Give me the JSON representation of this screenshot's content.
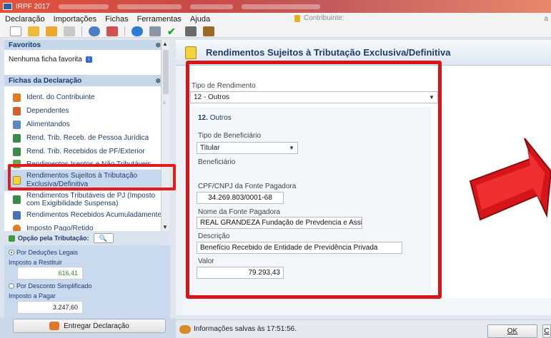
{
  "window": {
    "title": "IRPF 2017"
  },
  "menu": [
    "Declaração",
    "Importações",
    "Fichas",
    "Ferramentas",
    "Ajuda"
  ],
  "contribuinte_label": "Contribuinte:",
  "contribuinte_right": "a",
  "sidebar": {
    "favorites_header": "Favoritos",
    "favorites_empty": "Nenhuma ficha favorita",
    "fichas_header": "Fichas da Declaração",
    "items": [
      {
        "label": "Ident. do Contribuinte",
        "icon": "person-icon",
        "color": "#e07b28"
      },
      {
        "label": "Dependentes",
        "icon": "dependents-icon",
        "color": "#d4602c"
      },
      {
        "label": "Alimentandos",
        "icon": "alimentandos-icon",
        "color": "#5a8ac2"
      },
      {
        "label": "Rend. Trib. Receb. de Pessoa Jurídica",
        "icon": "income-pj-icon",
        "color": "#3b8a4a"
      },
      {
        "label": "Rend. Trib. Recebidos de PF/Exterior",
        "icon": "income-pf-icon",
        "color": "#3b8a4a"
      },
      {
        "label": "Rendimentos Isentos e Não Tributáveis",
        "icon": "exempt-income-icon",
        "color": "#6aa84f"
      },
      {
        "label": "Rendimentos Sujeitos à Tributação Exclusiva/Definitiva",
        "icon": "warning-icon",
        "color": "#f2d33a"
      },
      {
        "label": "Rendimentos Tributáveis de PJ (Imposto com Exigibilidade Suspensa)",
        "icon": "suspended-income-icon",
        "color": "#3b8a4a"
      },
      {
        "label": "Rendimentos Recebidos Acumuladamente",
        "icon": "accumulated-income-icon",
        "color": "#4a72b8"
      },
      {
        "label": "Imposto Pago/Retido",
        "icon": "tax-paid-icon",
        "color": "#e07b28"
      }
    ]
  },
  "tributacao": {
    "header": "Opção pela Tributação:",
    "deducoes_label": "Por Deduções Legais",
    "restituir_label": "Imposto a Restituir",
    "restituir_value": "616,41",
    "simplificado_label": "Por Desconto Simplificado",
    "pagar_label": "Imposto a Pagar",
    "pagar_value": "3.247,60"
  },
  "deliver_button": "Entregar Declaração",
  "main": {
    "title": "Rendimentos Sujeitos à Tributação Exclusiva/Definitiva",
    "tipo_rendimento_label": "Tipo de Rendimento",
    "tipo_rendimento_value": "12 - Outros",
    "section_number": "12.",
    "section_title": "Outros",
    "tipo_beneficiario_label": "Tipo de Beneficiário",
    "tipo_beneficiario_value": "Titular",
    "beneficiario_label": "Beneficiário",
    "cpf_label": "CPF/CNPJ da Fonte Pagadora",
    "cpf_value": "34.269.803/0001-68",
    "nome_label": "Nome da Fonte Pagadora",
    "nome_value": "REAL GRANDEZA Fundação de Prevdencia e Assist Social",
    "descricao_label": "Descrição",
    "descricao_value": "Benefício Recebido de Entidade de Previdência Privada",
    "valor_label": "Valor",
    "valor_value": "79.293,43"
  },
  "status": {
    "saved_text": "Informações salvas às 17:51:56."
  },
  "buttons": {
    "ok": "OK",
    "cancel": "C"
  },
  "colors": {
    "highlight_red": "#d5151a",
    "header_blue": "#1f3c6e"
  }
}
